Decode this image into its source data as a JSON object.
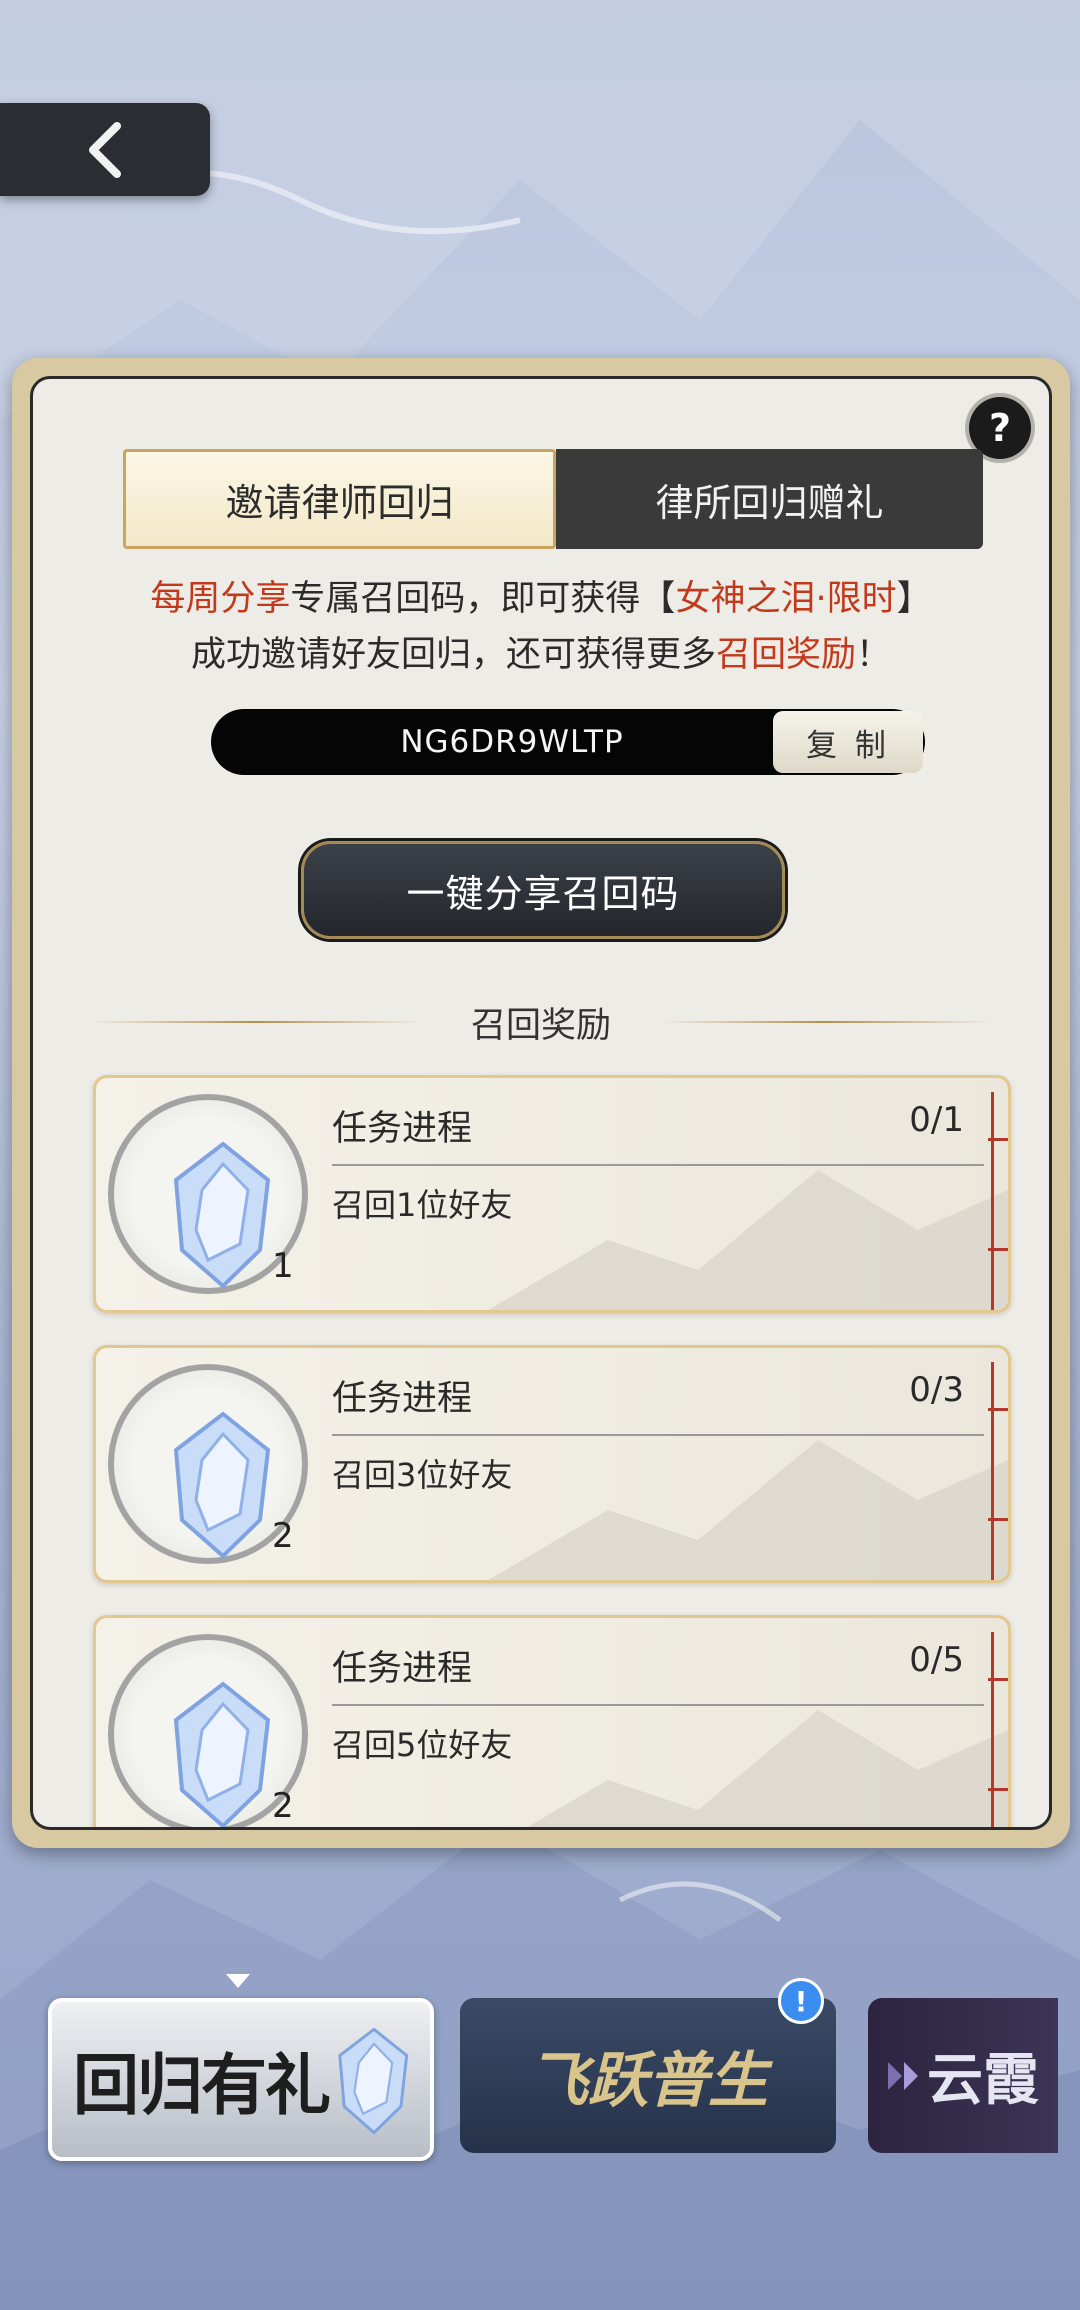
{
  "header": {
    "back_icon": "chevron-left-icon"
  },
  "panel": {
    "help_label": "?",
    "tabs": [
      {
        "label": "邀请律师回归",
        "active": true
      },
      {
        "label": "律所回归赠礼",
        "active": false
      }
    ],
    "description": {
      "line1_a": "每周分享",
      "line1_b": "专属召回码，即可获得【",
      "line1_c": "女神之泪·限时",
      "line1_d": "】",
      "line2_a": "成功邀请好友回归，还可获得更多",
      "line2_b": "召回奖励",
      "line2_c": "！"
    },
    "invite_code": "NG6DR9WLTP",
    "copy_label": "复 制",
    "share_label": "一键分享召回码",
    "section_title": "召回奖励",
    "rewards": [
      {
        "task_title": "任务进程",
        "progress": "0/1",
        "desc": "召回1位好友",
        "count": "1"
      },
      {
        "task_title": "任务进程",
        "progress": "0/3",
        "desc": "召回3位好友",
        "count": "2"
      },
      {
        "task_title": "任务进程",
        "progress": "0/5",
        "desc": "召回5位好友",
        "count": "2"
      }
    ]
  },
  "bottom_banners": [
    {
      "label": "回归有礼",
      "selected": true
    },
    {
      "label": "飞跃普生",
      "alert": "!"
    },
    {
      "label": "云霞"
    }
  ],
  "colors": {
    "accent_red": "#c2391c",
    "gold": "#c8a560",
    "dark": "#2b2d33"
  }
}
